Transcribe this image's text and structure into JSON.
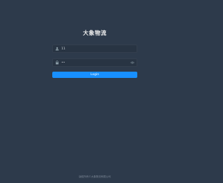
{
  "login": {
    "title": "大象物流",
    "username": {
      "value": "11",
      "icon": "user-icon"
    },
    "password": {
      "value": "••",
      "icon": "lock-icon",
      "toggle_icon": "eye-icon"
    },
    "login_label": "Login"
  },
  "footer": {
    "text": "版权所有©大象物流有限公司"
  },
  "colors": {
    "background": "#2d3a4b",
    "input_background": "#283443",
    "accent": "#1890ff"
  }
}
